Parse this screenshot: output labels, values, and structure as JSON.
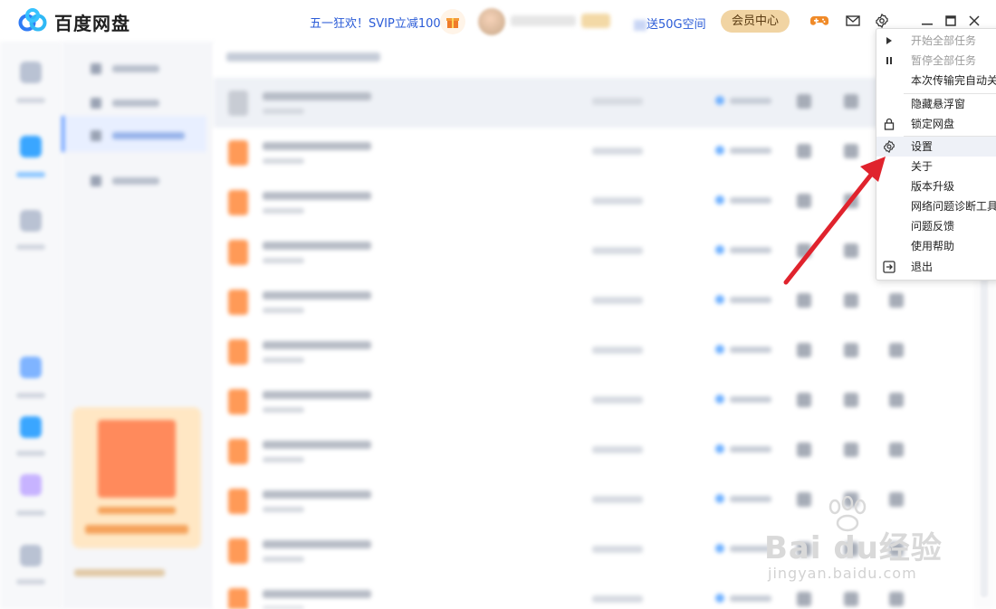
{
  "app": {
    "brand": "百度网盘",
    "colors": {
      "accent": "#2a5bd7",
      "member": "#f1d4a3",
      "arrow": "#e0232d",
      "selected": "#4e8cff"
    }
  },
  "header": {
    "promo": "五一狂欢！SVIP立减100",
    "gift_space_suffix": "送50G空间",
    "member_button": "会员中心",
    "icons": [
      "gift-icon",
      "gamepad-icon",
      "mail-icon",
      "gear-icon",
      "minimize-icon",
      "maximize-icon",
      "close-icon"
    ]
  },
  "menu": {
    "items": [
      {
        "label": "开始全部任务",
        "icon": "play-icon",
        "disabled": true
      },
      {
        "label": "暂停全部任务",
        "icon": "pause-icon",
        "disabled": true
      },
      {
        "label": "本次传输完自动关",
        "icon": "",
        "disabled": false
      },
      {
        "label": "隐藏悬浮窗",
        "icon": "",
        "disabled": false
      },
      {
        "label": "锁定网盘",
        "icon": "lock-icon",
        "disabled": false
      },
      {
        "label": "设置",
        "icon": "gear-icon",
        "disabled": false,
        "hover": true
      },
      {
        "label": "关于",
        "icon": "",
        "disabled": false
      },
      {
        "label": "版本升级",
        "icon": "",
        "disabled": false
      },
      {
        "label": "网络问题诊断工具",
        "icon": "",
        "disabled": false
      },
      {
        "label": "问题反馈",
        "icon": "",
        "disabled": false
      },
      {
        "label": "使用帮助",
        "icon": "",
        "disabled": false
      },
      {
        "label": "退出",
        "icon": "exit-icon",
        "disabled": false
      }
    ]
  },
  "watermark": {
    "main": "Bai du经验",
    "sub": "jingyan.baidu.com"
  }
}
